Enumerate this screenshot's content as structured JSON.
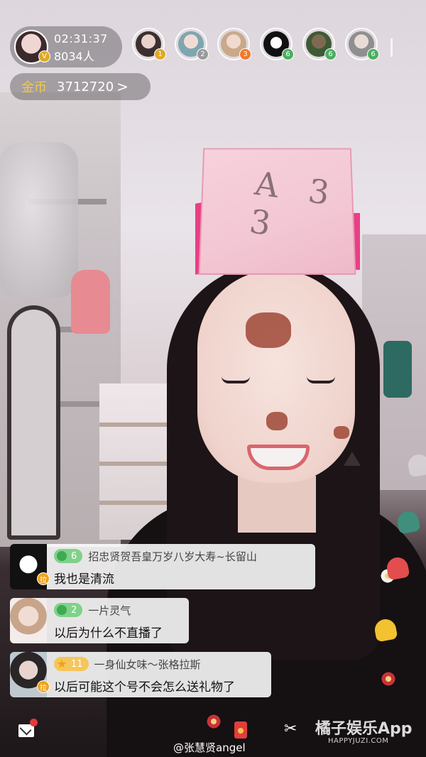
{
  "host": {
    "duration": "02:31:37",
    "audience": "8034人",
    "level": "V"
  },
  "coins": {
    "label": "金币",
    "value": "3712720",
    "arrow": ">"
  },
  "viewers": [
    {
      "badge": "1",
      "badge_color": "#e0a82a"
    },
    {
      "badge": "2",
      "badge_color": "#9a9a9a"
    },
    {
      "badge": "3",
      "badge_color": "#f07a2a"
    },
    {
      "badge": "6",
      "badge_color": "#4cae62"
    },
    {
      "badge": "6",
      "badge_color": "#4cae62"
    },
    {
      "badge": "6",
      "badge_color": "#4cae62"
    }
  ],
  "hat": {
    "text": "A 3 3"
  },
  "chat": [
    {
      "level": "6",
      "name": "招忠贤贺吾皇万岁八岁大寿~长留山",
      "text": "我也是清流",
      "host_tag": "拉"
    },
    {
      "level": "2",
      "name": "一片灵气",
      "text": "以后为什么不直播了",
      "host_tag": ""
    },
    {
      "level": "11",
      "name": "一身仙女味～张格拉斯",
      "text": "以后可能这个号不会怎么送礼物了",
      "host_tag": "拉"
    }
  ],
  "bottom": {
    "scissor": "✂",
    "credit": "@张慧贤angel",
    "watermark": "橘子娱乐App",
    "watermark_url": "HAPPYJUZI.COM"
  }
}
